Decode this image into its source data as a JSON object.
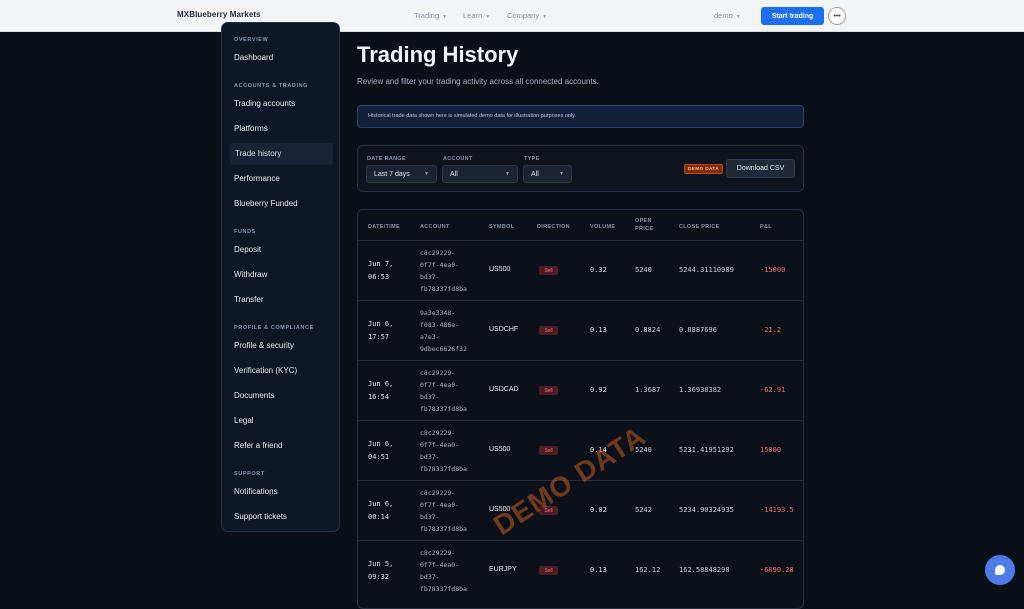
{
  "header": {
    "brand": "MXBlueberry Markets",
    "nav": [
      "Trading",
      "Learn",
      "Company"
    ],
    "account_selector": "demo",
    "start_button": "Start trading",
    "more_icon": "more-icon"
  },
  "sidebar": {
    "sections": [
      {
        "heading": "OVERVIEW",
        "items": [
          "Dashboard"
        ]
      },
      {
        "heading": "ACCOUNTS & TRADING",
        "items": [
          "Trading accounts",
          "Platforms",
          "Trade history",
          "Performance",
          "Blueberry Funded"
        ]
      },
      {
        "heading": "FUNDS",
        "items": [
          "Deposit",
          "Withdraw",
          "Transfer"
        ]
      },
      {
        "heading": "PROFILE & COMPLIANCE",
        "items": [
          "Profile & security",
          "Verification (KYC)",
          "Documents",
          "Legal",
          "Refer a friend"
        ]
      },
      {
        "heading": "SUPPORT",
        "items": [
          "Notifications",
          "Support tickets"
        ]
      }
    ],
    "active_item": "Trade history"
  },
  "page": {
    "title": "Trading History",
    "subtitle": "Review and filter your trading activity across all connected accounts.",
    "notice": "Historical trade data shown here is simulated demo data for illustration purposes only."
  },
  "filters": {
    "date_range": {
      "label": "DATE RANGE",
      "value": "Last 7 days"
    },
    "account": {
      "label": "ACCOUNT",
      "value": "All"
    },
    "type": {
      "label": "TYPE",
      "value": "All"
    },
    "demo_badge": "DEMO DATA",
    "download_button": "Download CSV"
  },
  "table": {
    "columns": [
      "DATE/TIME",
      "ACCOUNT",
      "SYMBOL",
      "DIRECTION",
      "VOLUME",
      "OPEN PRICE",
      "CLOSE PRICE",
      "P&L"
    ],
    "rows": [
      {
        "date": "Jun 7,",
        "time": "06:53",
        "account": [
          "c8c29229-",
          "0f7f-4ea0-",
          "bd37-",
          "fb78337fd8ba"
        ],
        "symbol": "US500",
        "direction": "Sell",
        "volume": "0.32",
        "open": "5240",
        "close": "5244.31110989",
        "pnl": "-15000"
      },
      {
        "date": "Jun 6,",
        "time": "17:57",
        "account": [
          "9a3e3348-",
          "f083-486e-",
          "a7e3-",
          "9dbec6626f32"
        ],
        "symbol": "USDCHF",
        "direction": "Sell",
        "volume": "0.13",
        "open": "0.8824",
        "close": "0.8887696",
        "pnl": "-21.2"
      },
      {
        "date": "Jun 6,",
        "time": "16:54",
        "account": [
          "c8c29229-",
          "0f7f-4ea0-",
          "bd37-",
          "fb78337fd8ba"
        ],
        "symbol": "USDCAD",
        "direction": "Sell",
        "volume": "0.92",
        "open": "1.3687",
        "close": "1.36938382",
        "pnl": "-62.91"
      },
      {
        "date": "Jun 6,",
        "time": "04:51",
        "account": [
          "c8c29229-",
          "0f7f-4ea0-",
          "bd37-",
          "fb78337fd8ba"
        ],
        "symbol": "US500",
        "direction": "Sell",
        "volume": "0.14",
        "open": "5240",
        "close": "5231.41951292",
        "pnl": "15000"
      },
      {
        "date": "Jun 6,",
        "time": "00:14",
        "account": [
          "c8c29229-",
          "0f7f-4ea0-",
          "bd37-",
          "fb78337fd8ba"
        ],
        "symbol": "US500",
        "direction": "Sell",
        "volume": "0.02",
        "open": "5242",
        "close": "5234.90324935",
        "pnl": "-14193.5"
      },
      {
        "date": "Jun 5,",
        "time": "09:32",
        "account": [
          "c8c29229-",
          "0f7f-4ea0-",
          "bd37-",
          "fb78337fd8ba"
        ],
        "symbol": "EURJPY",
        "direction": "Sell",
        "volume": "0.13",
        "open": "162.12",
        "close": "162.58848298",
        "pnl": "-6090.28"
      }
    ]
  },
  "watermark": "DEMO DATA",
  "colors": {
    "accent": "#1d6ff2",
    "negative": "#f87171",
    "sell_badge_bg": "#4c1d24",
    "demo_badge": "#c2410c"
  }
}
